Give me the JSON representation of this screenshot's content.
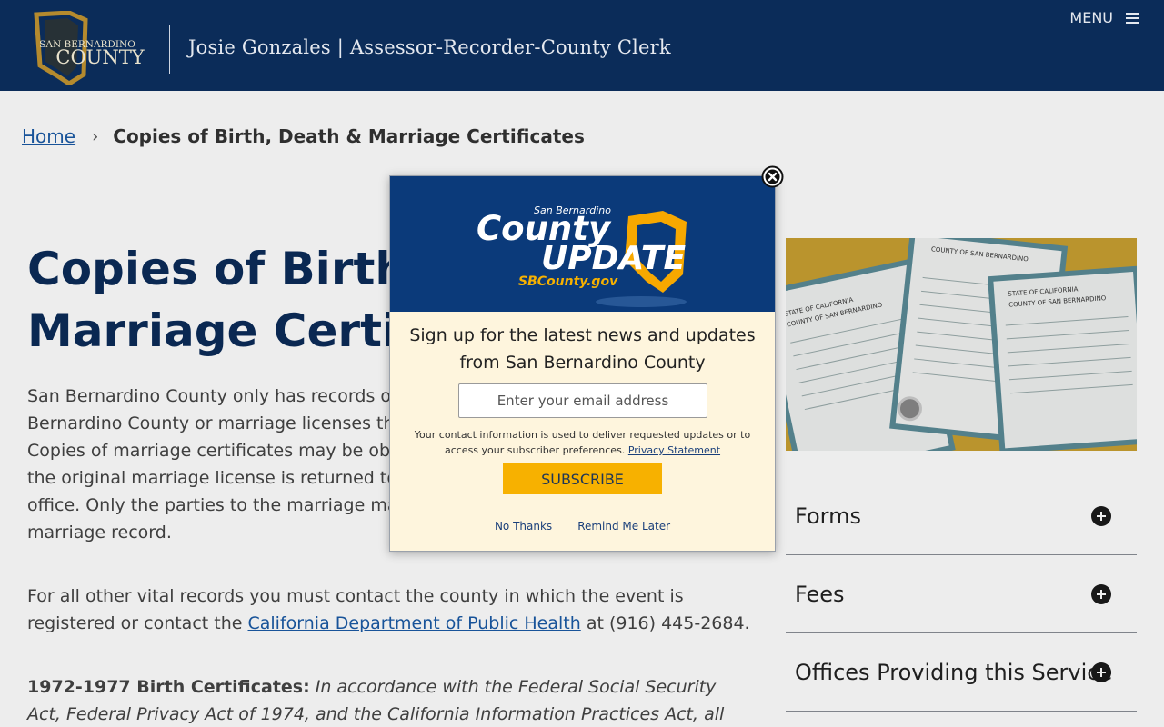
{
  "header": {
    "seal_text_line1": "SAN BERNARDINO",
    "seal_text_line2": "COUNTY",
    "title": "Josie Gonzales | Assessor-Recorder-County Clerk",
    "menu_label": "MENU",
    "seal_color": "#b48a2e",
    "bg_color": "#0b2c59"
  },
  "breadcrumb": {
    "home": "Home",
    "separator": "›",
    "current": "Copies of Birth, Death & Marriage Certificates"
  },
  "main": {
    "title_line1": "Copies of Birth, Death &",
    "title_line2": "Marriage Certificates",
    "para1": "San Bernardino County only has records of births and deaths that occurred in San Bernardino County or marriage licenses that were issued in San Bernardino County. Copies of marriage certificates may be obtained approximately three weeks after the original marriage license is returned to the Assessor-Recorder-County Clerk’s office. Only the parties to the marriage may obtain a certified copy of a confidential marriage record.",
    "para2_before": "For all other vital records you must contact the county in which the event is registered or contact the ",
    "para2_link": "California Department of Public Health",
    "para2_after": " at (916) 445-2684.",
    "para3_label": "1972-1977 Birth Certificates:",
    "para3_text": " In accordance with the Federal Social Security Act, Federal Privacy Act of 1974, and the California Information Practices Act, all social"
  },
  "sidebar": {
    "image_alt": "certificates-image",
    "cert_header_1": "STATE OF CALIFORNIA",
    "cert_header_2": "COUNTY OF SAN BERNARDINO",
    "accordion": [
      {
        "label": "Forms"
      },
      {
        "label": "Fees"
      },
      {
        "label": "Offices Providing this Service"
      }
    ]
  },
  "popup": {
    "brand_small": "San Bernardino",
    "brand_county": "County",
    "brand_update": "UPDATE",
    "brand_url": "SBCounty.gov",
    "heading": "Sign up for the latest news and updates from San Bernardino County",
    "email_placeholder": "Enter your email address",
    "note": "Your contact information is used to deliver requested updates or to access your subscriber preferences.",
    "privacy_link": "Privacy Statement",
    "subscribe_label": "SUBSCRIBE",
    "no_thanks": "No Thanks",
    "remind_later": "Remind Me Later",
    "accent_color": "#f7b100",
    "banner_color": "#0b3a7a"
  }
}
